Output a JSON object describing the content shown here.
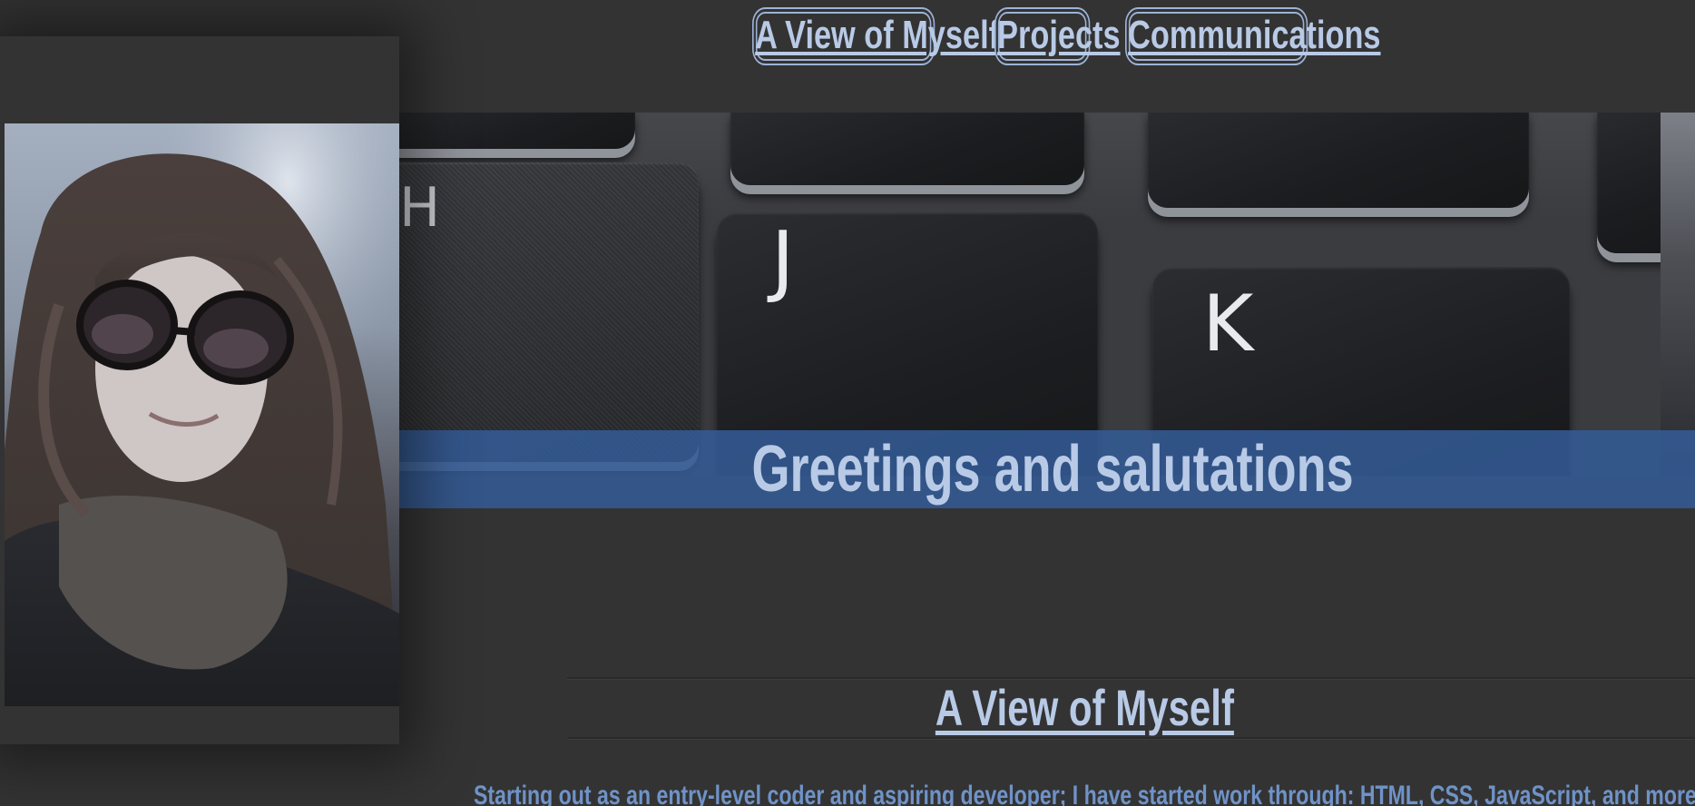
{
  "nav": {
    "items": [
      {
        "label": "A View of Myself"
      },
      {
        "label": "Projects"
      },
      {
        "label": "Communications"
      }
    ]
  },
  "banner": {
    "greeting": "Greetings and salutations",
    "keys": [
      "H",
      "J",
      "K"
    ]
  },
  "section": {
    "title": "A View of Myself",
    "intro": "Starting out as an entry-level coder and aspiring developer; I have started work through: HTML, CSS, JavaScript, and more through the"
  },
  "colors": {
    "background": "#333333",
    "accent": "#b8cae6",
    "greeting_bar": "#345c98",
    "body_text": "#6f93c8"
  }
}
